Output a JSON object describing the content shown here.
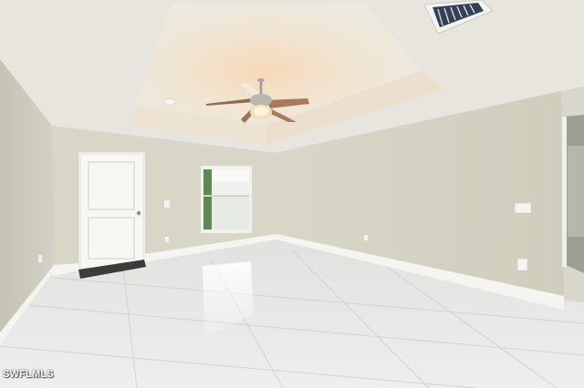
{
  "watermark": {
    "text": "SWFLMLS"
  },
  "colors": {
    "ceiling": "#e9e7df",
    "tray_ceiling": "#f0e6d6",
    "wall_left": "#cfcec2",
    "wall_back": "#d6d4c6",
    "wall_right": "#d3d2c2",
    "baseboard": "#f4f4f0",
    "floor": "#e8e8e6",
    "floor_grout": "#cfcfcc",
    "door": "#f6f6f3",
    "door_mat": "#3c3c3c",
    "fan_blade": "#a8795a",
    "fan_light": "#f3e0b8"
  },
  "icons": {
    "ceiling_fan": "ceiling-fan-icon",
    "air_vent": "air-vent-icon",
    "smoke_detector": "smoke-detector-icon",
    "light_switch": "light-switch-icon",
    "power_outlet": "power-outlet-icon"
  }
}
